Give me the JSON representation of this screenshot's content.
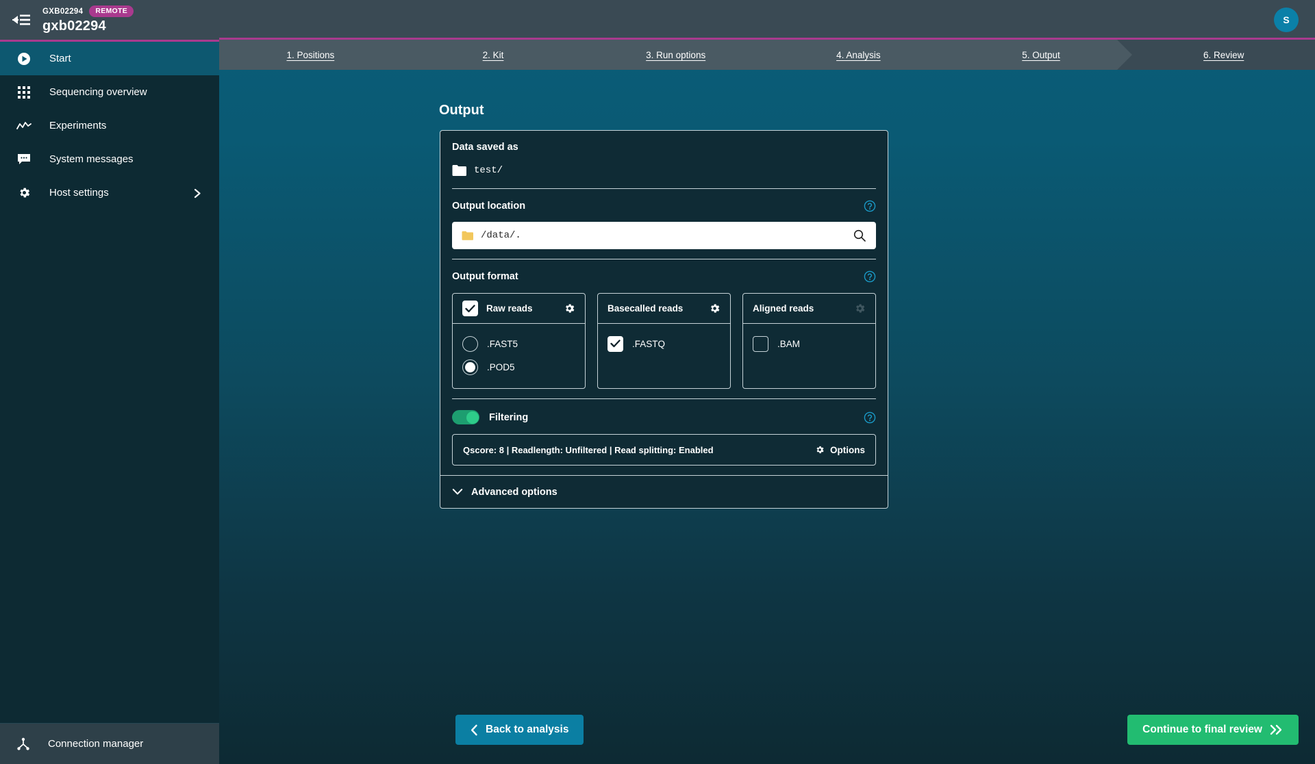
{
  "sidebar": {
    "collapse_icon": "collapse-sidebar-icon",
    "device_id": "GXB02294",
    "device_badge": "REMOTE",
    "device_name": "gxb02294",
    "items": [
      {
        "label": "Start",
        "icon": "play-circle-icon",
        "active": true
      },
      {
        "label": "Sequencing overview",
        "icon": "grid-icon",
        "active": false
      },
      {
        "label": "Experiments",
        "icon": "line-chart-icon",
        "active": false
      },
      {
        "label": "System messages",
        "icon": "message-icon",
        "active": false
      },
      {
        "label": "Host settings",
        "icon": "gear-icon",
        "active": false,
        "chevron": true
      }
    ],
    "bottom": {
      "label": "Connection manager",
      "icon": "connection-icon"
    }
  },
  "topbar": {
    "avatar_initial": "S"
  },
  "steps": [
    {
      "label": "1. Positions",
      "active": false
    },
    {
      "label": "2. Kit",
      "active": false
    },
    {
      "label": "3. Run options",
      "active": false
    },
    {
      "label": "4. Analysis",
      "active": false
    },
    {
      "label": "5. Output",
      "active": false
    },
    {
      "label": "6. Review",
      "active": true
    }
  ],
  "main": {
    "page_title": "Output",
    "data_saved_as": {
      "title": "Data saved as",
      "folder_icon": "folder-icon",
      "path": "test/"
    },
    "output_location": {
      "title": "Output location",
      "help_icon": "help-circle-icon",
      "value": "/data/.",
      "placeholder": "/data/.",
      "folder_icon": "folder-icon",
      "search_icon": "search-icon"
    },
    "output_format": {
      "title": "Output format",
      "help_icon": "help-circle-icon",
      "cards": [
        {
          "name": "Raw reads",
          "header_control": "checkbox",
          "header_checked": true,
          "gear_enabled": true,
          "options": [
            {
              "label": ".FAST5",
              "control": "radio",
              "checked": false
            },
            {
              "label": ".POD5",
              "control": "radio",
              "checked": true
            }
          ]
        },
        {
          "name": "Basecalled reads",
          "header_control": "none",
          "header_checked": false,
          "gear_enabled": true,
          "options": [
            {
              "label": ".FASTQ",
              "control": "checkbox",
              "checked": true
            }
          ]
        },
        {
          "name": "Aligned reads",
          "header_control": "none",
          "header_checked": false,
          "gear_enabled": false,
          "options": [
            {
              "label": ".BAM",
              "control": "checkbox",
              "checked": false
            }
          ]
        }
      ]
    },
    "filtering": {
      "label": "Filtering",
      "enabled": true,
      "help_icon": "help-circle-icon",
      "summary": "Qscore: 8 | Readlength: Unfiltered | Read splitting: Enabled",
      "options_label": "Options",
      "options_icon": "gear-icon"
    },
    "advanced_options": {
      "label": "Advanced options",
      "icon": "chevron-down-icon"
    }
  },
  "footer": {
    "back_label": "Back to analysis",
    "back_icon": "chevron-left-icon",
    "continue_label": "Continue to final review",
    "continue_icon": "double-chevron-right-icon"
  },
  "colors": {
    "accent_magenta": "#a93a8e",
    "sidebar_bg": "#0d2a33",
    "sidebar_active": "#0d5870",
    "topbar_bg": "#3a4a54",
    "steps_bg": "#4a5a63",
    "avatar_bg": "#0b80a8",
    "back_button": "#0b7fa3",
    "continue_button": "#22bc71",
    "toggle_on": "#2ecc8a",
    "folder_yellow": "#f2c75c",
    "help_blue": "#1a9ac7"
  }
}
